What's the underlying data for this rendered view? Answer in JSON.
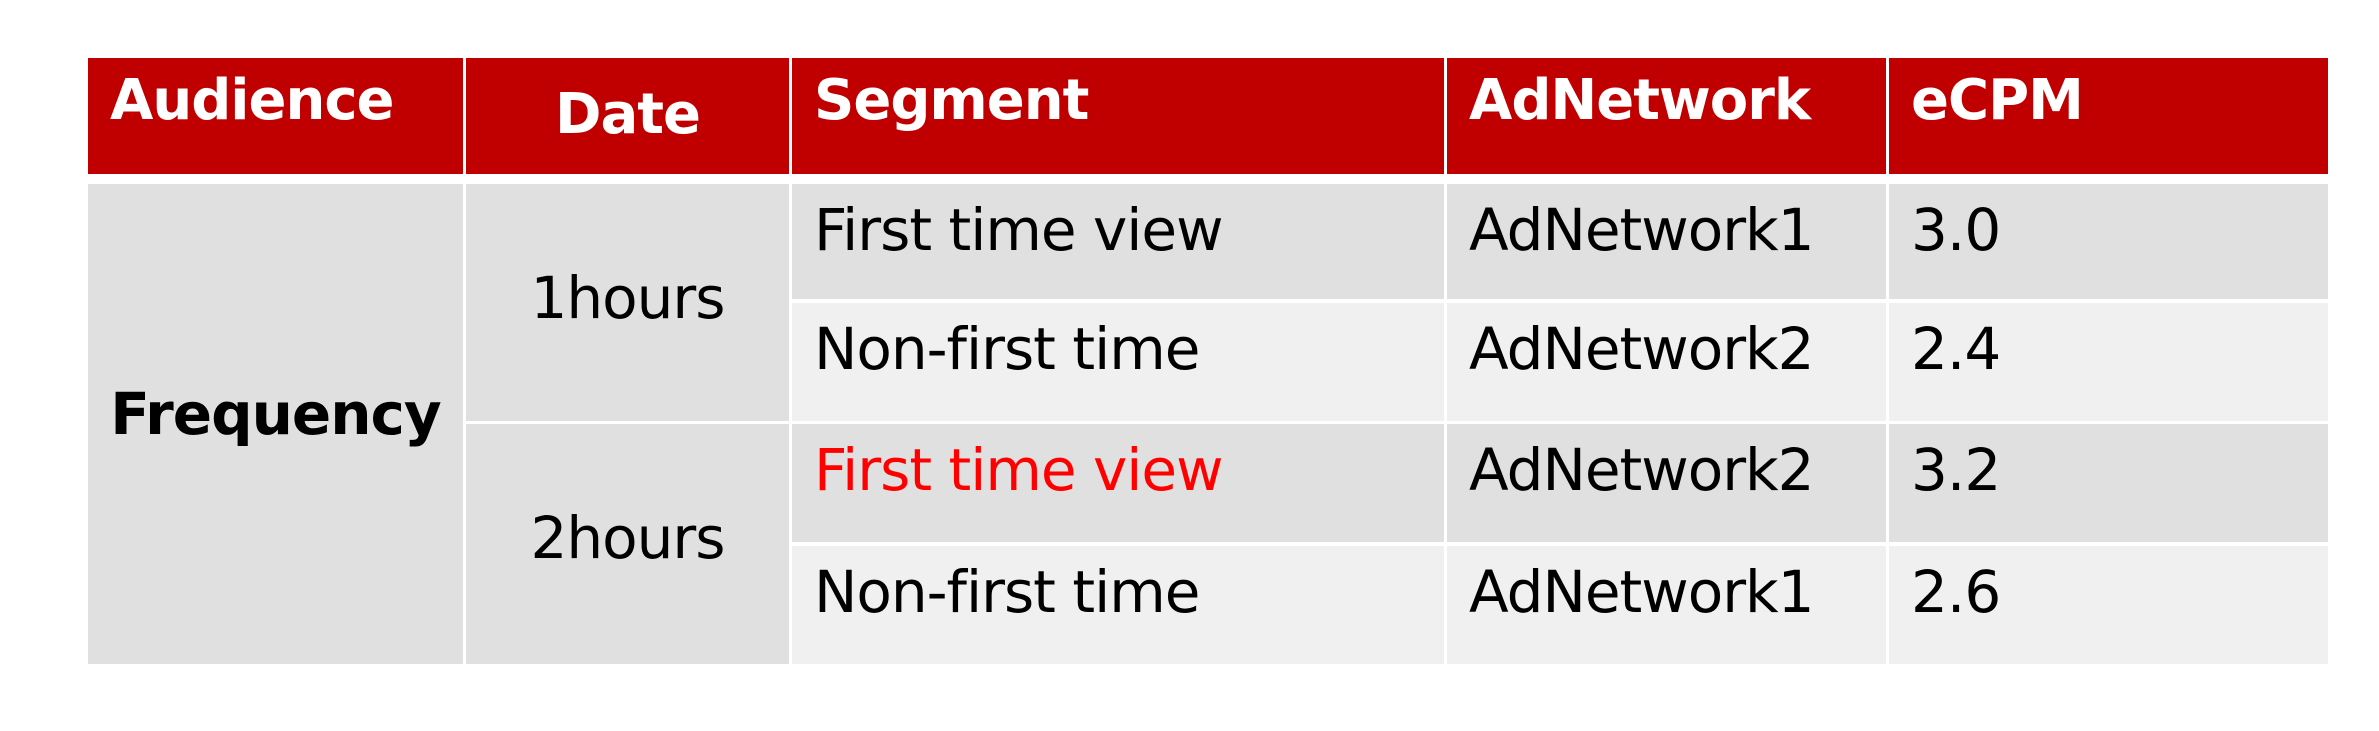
{
  "table": {
    "headers": [
      "Audience",
      "Date",
      "Segment",
      "AdNetwork",
      "eCPM"
    ],
    "audience": "Frequency",
    "date_groups": [
      {
        "label": "1hours"
      },
      {
        "label": "2hours"
      }
    ],
    "rows": [
      {
        "segment": "First time view",
        "adnetwork": "AdNetwork1",
        "ecpm": "3.0",
        "highlight": false
      },
      {
        "segment": "Non-first time",
        "adnetwork": "AdNetwork2",
        "ecpm": "2.4",
        "highlight": false
      },
      {
        "segment": "First time view",
        "adnetwork": "AdNetwork2",
        "ecpm": "3.2",
        "highlight": true
      },
      {
        "segment": "Non-first time",
        "adnetwork": "AdNetwork1",
        "ecpm": "2.6",
        "highlight": false
      }
    ]
  },
  "colors": {
    "header_bg": "#C00000",
    "row_odd_bg": "#E0E0E0",
    "row_even_bg": "#F0F0F0",
    "highlight_text": "#FF0000"
  }
}
